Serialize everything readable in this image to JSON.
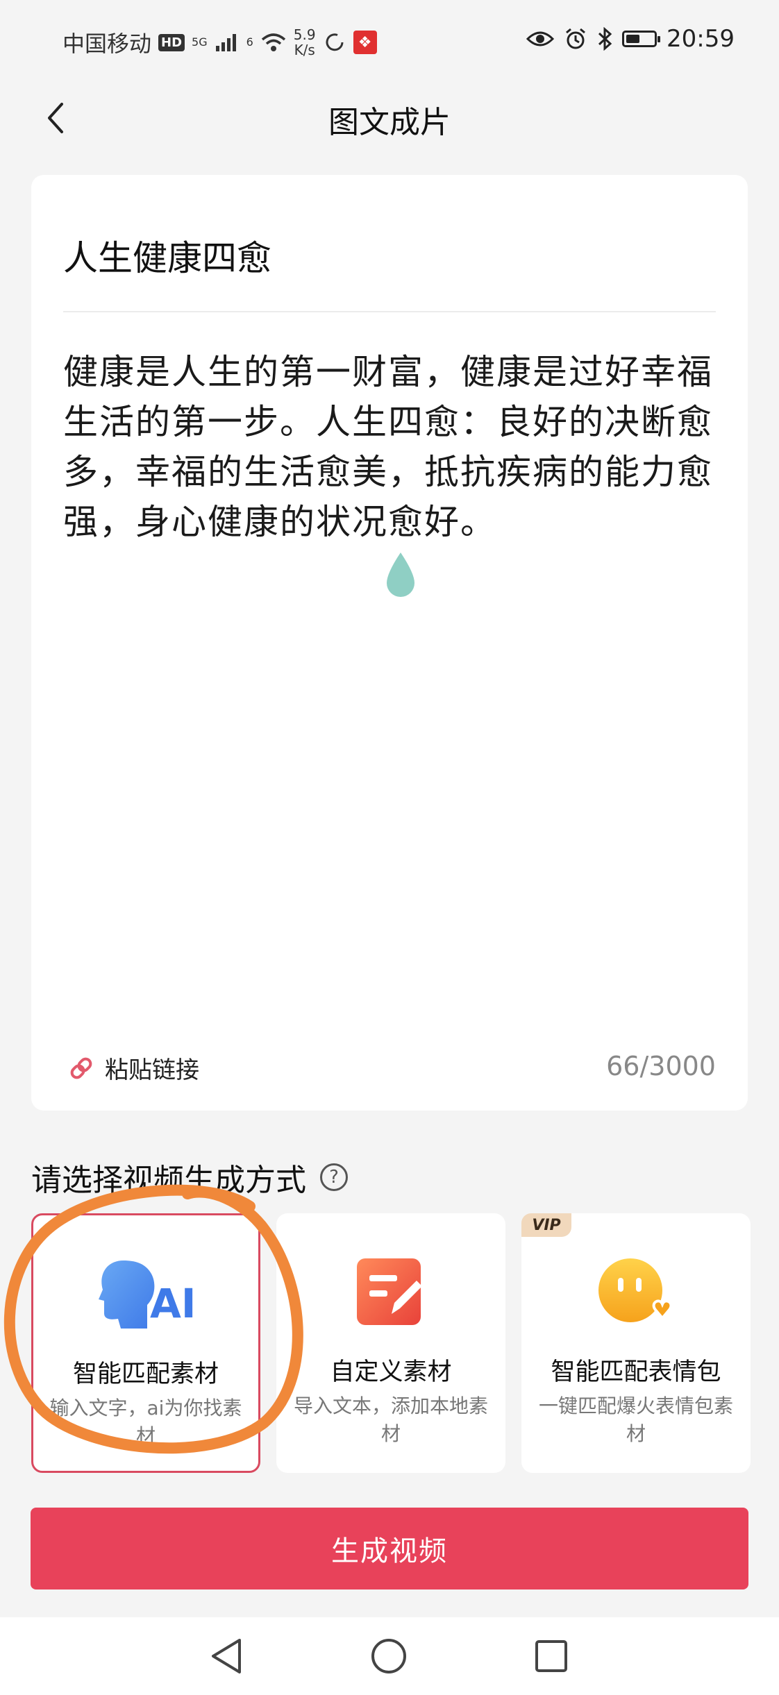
{
  "status_bar": {
    "carrier": "中国移动",
    "hd": "HD",
    "net_5g": "5G",
    "wifi_superscript": "6",
    "speed_value": "5.9",
    "speed_unit": "K/s",
    "time": "20:59",
    "battery_level": 0.5
  },
  "header": {
    "title": "图文成片"
  },
  "editor": {
    "title": "人生健康四愈",
    "body": "健康是人生的第一财富，健康是过好幸福生活的第一步。人生四愈：良好的决断愈多，幸福的生活愈美，抵抗疾病的能力愈强，身心健康的状况愈好。",
    "paste_label": "粘贴链接",
    "char_count": "66/3000"
  },
  "section": {
    "title": "请选择视频生成方式"
  },
  "options": [
    {
      "title": "智能匹配素材",
      "desc": "输入文字，ai为你找素材",
      "icon": "ai-head-icon",
      "icon_text": "AI"
    },
    {
      "title": "自定义素材",
      "desc": "导入文本，添加本地素材",
      "icon": "edit-document-icon"
    },
    {
      "title": "智能匹配表情包",
      "desc": "一键匹配爆火表情包素材",
      "icon": "emoji-heart-icon",
      "badge": "VIP"
    }
  ],
  "cta": {
    "label": "生成视频"
  },
  "colors": {
    "accent": "#e8425a",
    "selected_border": "#d94a60",
    "annotation": "#f0883a"
  }
}
